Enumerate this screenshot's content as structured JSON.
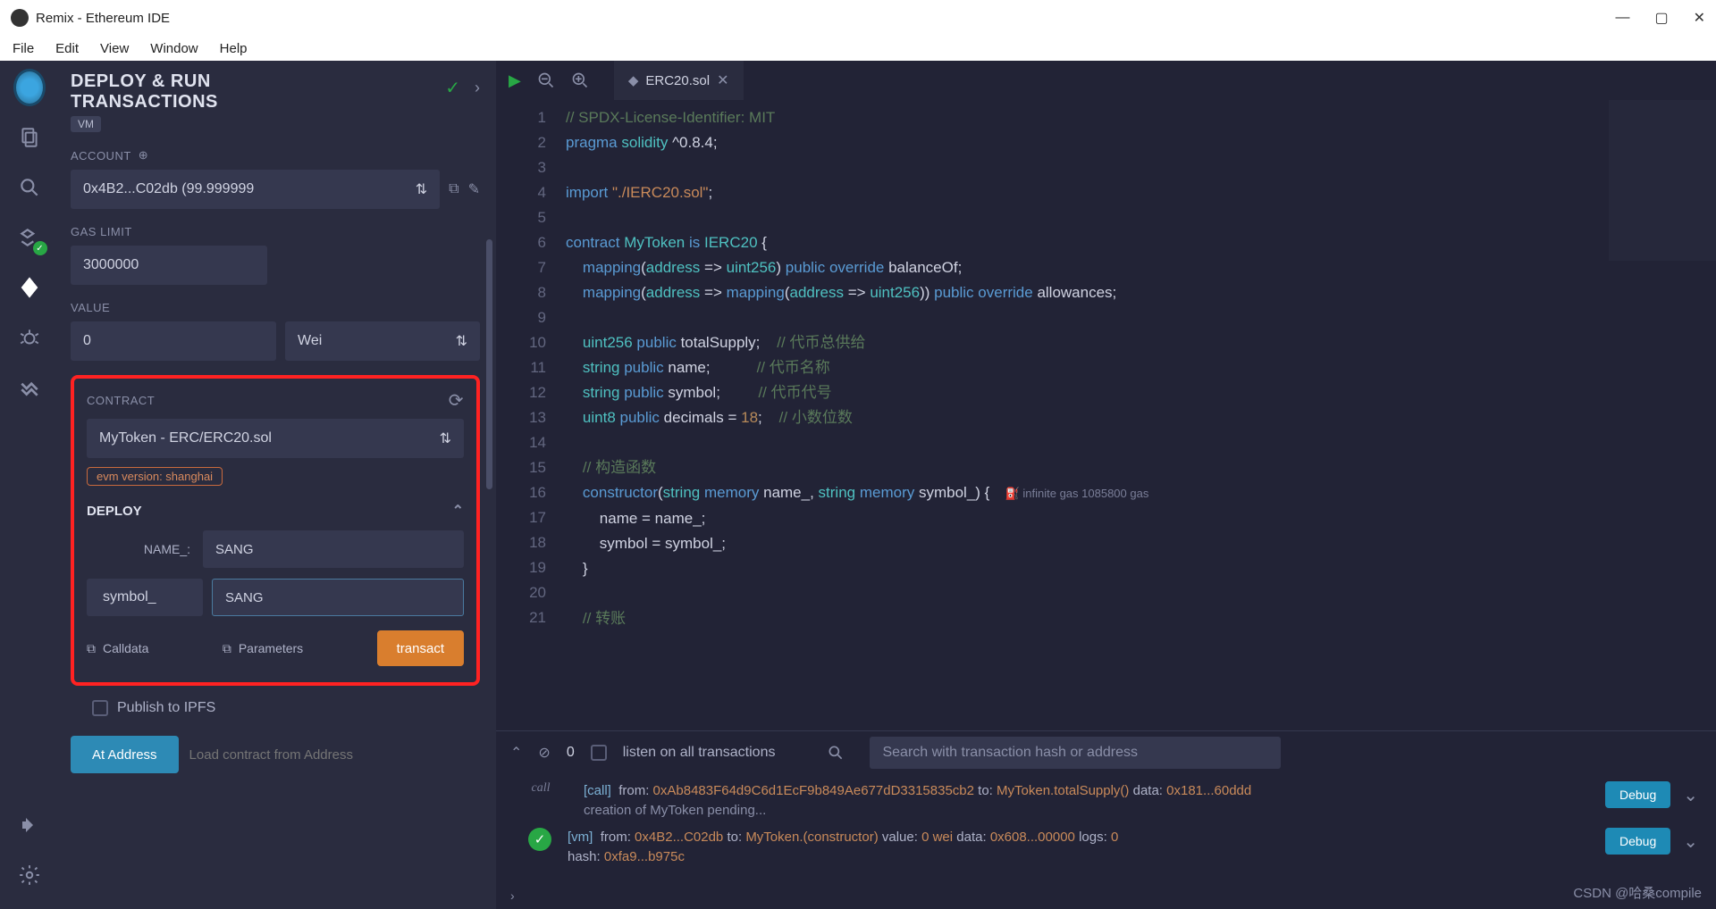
{
  "window": {
    "title": "Remix - Ethereum IDE"
  },
  "menubar": [
    "File",
    "Edit",
    "View",
    "Window",
    "Help"
  ],
  "panel": {
    "title_l1": "DEPLOY & RUN",
    "title_l2": "TRANSACTIONS",
    "vm_badge": "VM",
    "account_label": "ACCOUNT",
    "account_value": "0x4B2...C02db (99.999999",
    "gas_label": "GAS LIMIT",
    "gas_value": "3000000",
    "value_label": "VALUE",
    "value_amount": "0",
    "value_unit": "Wei",
    "contract_label": "CONTRACT",
    "contract_value": "MyToken - ERC/ERC20.sol",
    "evm_badge": "evm version: shanghai",
    "deploy_label": "DEPLOY",
    "param_name_label": "NAME_:",
    "param_name_value": "SANG",
    "param_symbol_label": "symbol_",
    "param_symbol_value": "SANG",
    "calldata_btn": "Calldata",
    "parameters_btn": "Parameters",
    "transact_btn": "transact",
    "publish_label": "Publish to IPFS",
    "at_address_btn": "At Address",
    "at_address_placeholder": "Load contract from Address"
  },
  "editor": {
    "tab_name": "ERC20.sol",
    "gas_hint": "infinite gas 1085800 gas",
    "lines": [
      {
        "n": 1,
        "html": "<span class='cm'>// SPDX-License-Identifier: MIT</span>"
      },
      {
        "n": 2,
        "html": "<span class='kw'>pragma</span> <span class='ty'>solidity</span> ^0.8.4;"
      },
      {
        "n": 3,
        "html": ""
      },
      {
        "n": 4,
        "html": "<span class='kw'>import</span> <span class='str'>\"./IERC20.sol\"</span>;"
      },
      {
        "n": 5,
        "html": ""
      },
      {
        "n": 6,
        "html": "<span class='kw'>contract</span> <span class='ty'>MyToken</span> <span class='kw'>is</span> <span class='ty'>IERC20</span> {"
      },
      {
        "n": 7,
        "html": "    <span class='kw'>mapping</span>(<span class='ty'>address</span> <span class='op'>=&gt;</span> <span class='ty'>uint256</span>) <span class='kw'>public</span> <span class='kw'>override</span> balanceOf;"
      },
      {
        "n": 8,
        "html": "    <span class='kw'>mapping</span>(<span class='ty'>address</span> <span class='op'>=&gt;</span> <span class='kw'>mapping</span>(<span class='ty'>address</span> <span class='op'>=&gt;</span> <span class='ty'>uint256</span>)) <span class='kw'>public</span> <span class='kw'>override</span> allowances;"
      },
      {
        "n": 9,
        "html": ""
      },
      {
        "n": 10,
        "html": "    <span class='ty'>uint256</span> <span class='kw'>public</span> totalSupply;    <span class='cc'>// 代币总供给</span>"
      },
      {
        "n": 11,
        "html": "    <span class='ty'>string</span> <span class='kw'>public</span> name;           <span class='cc'>// 代币名称</span>"
      },
      {
        "n": 12,
        "html": "    <span class='ty'>string</span> <span class='kw'>public</span> symbol;         <span class='cc'>// 代币代号</span>"
      },
      {
        "n": 13,
        "html": "    <span class='ty'>uint8</span> <span class='kw'>public</span> decimals = <span class='num'>18</span>;    <span class='cc'>// 小数位数</span>"
      },
      {
        "n": 14,
        "html": ""
      },
      {
        "n": 15,
        "html": "    <span class='cc'>// 构造函数</span>"
      },
      {
        "n": 16,
        "html": "    <span class='kw'>constructor</span>(<span class='ty'>string</span> <span class='kw'>memory</span> name_, <span class='ty'>string</span> <span class='kw'>memory</span> symbol_) {",
        "gas": true
      },
      {
        "n": 17,
        "html": "        name = name_;"
      },
      {
        "n": 18,
        "html": "        symbol = symbol_;"
      },
      {
        "n": 19,
        "html": "    }"
      },
      {
        "n": 20,
        "html": ""
      },
      {
        "n": 21,
        "html": "    <span class='cc'>// 转账</span>"
      }
    ]
  },
  "terminal": {
    "count": "0",
    "listen_label": "listen on all transactions",
    "search_placeholder": "Search with transaction hash or address",
    "debug_btn": "Debug",
    "rows": [
      {
        "badge": "call",
        "text": "<span class='lk'>[call]</span> &nbsp;<span>from:</span> <span class='lv'>0xAb8483F64d9C6d1EcF9b849Ae677dD3315835cb2</span> <span>to:</span> <span class='lv'>MyToken.totalSupply()</span> <span>data:</span> <span class='lv'>0x181...60ddd</span>",
        "sub": "creation of MyToken pending...",
        "debug": true
      },
      {
        "ok": true,
        "text": "<span class='lk'>[vm]</span> &nbsp;<span>from:</span> <span class='lv'>0x4B2...C02db</span> <span>to:</span> <span class='lv'>MyToken.(constructor)</span> <span>value:</span> <span class='lv'>0 wei</span> <span>data:</span> <span class='lv'>0x608...00000</span> <span>logs:</span> <span class='lv'>0</span><br><span>hash:</span> <span class='lv'>0xfa9...b975c</span>",
        "debug": true
      }
    ]
  },
  "watermark": "CSDN @哈桑compile"
}
